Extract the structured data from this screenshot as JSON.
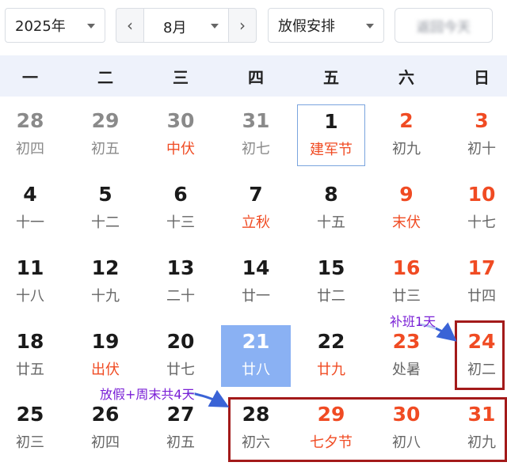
{
  "toolbar": {
    "year_label": "2025年",
    "month_label": "8月",
    "prev_arrow": "‹",
    "next_arrow": "›",
    "holiday_label": "放假安排",
    "today_label": "返回今天"
  },
  "weekdays": [
    "一",
    "二",
    "三",
    "四",
    "五",
    "六",
    "日"
  ],
  "days": [
    {
      "n": "28",
      "s": "初四"
    },
    {
      "n": "29",
      "s": "初五"
    },
    {
      "n": "30",
      "s": "中伏"
    },
    {
      "n": "31",
      "s": "初七"
    },
    {
      "n": "1",
      "s": "建军节"
    },
    {
      "n": "2",
      "s": "初九"
    },
    {
      "n": "3",
      "s": "初十"
    },
    {
      "n": "4",
      "s": "十一"
    },
    {
      "n": "5",
      "s": "十二"
    },
    {
      "n": "6",
      "s": "十三"
    },
    {
      "n": "7",
      "s": "立秋"
    },
    {
      "n": "8",
      "s": "十五"
    },
    {
      "n": "9",
      "s": "末伏"
    },
    {
      "n": "10",
      "s": "十七"
    },
    {
      "n": "11",
      "s": "十八"
    },
    {
      "n": "12",
      "s": "十九"
    },
    {
      "n": "13",
      "s": "二十"
    },
    {
      "n": "14",
      "s": "廿一"
    },
    {
      "n": "15",
      "s": "廿二"
    },
    {
      "n": "16",
      "s": "廿三"
    },
    {
      "n": "17",
      "s": "廿四"
    },
    {
      "n": "18",
      "s": "廿五"
    },
    {
      "n": "19",
      "s": "出伏"
    },
    {
      "n": "20",
      "s": "廿七"
    },
    {
      "n": "21",
      "s": "廿八"
    },
    {
      "n": "22",
      "s": "廿九"
    },
    {
      "n": "23",
      "s": "处暑"
    },
    {
      "n": "24",
      "s": "初二"
    },
    {
      "n": "25",
      "s": "初三"
    },
    {
      "n": "26",
      "s": "初四"
    },
    {
      "n": "27",
      "s": "初五"
    },
    {
      "n": "28",
      "s": "初六"
    },
    {
      "n": "29",
      "s": "七夕节"
    },
    {
      "n": "30",
      "s": "初八"
    },
    {
      "n": "31",
      "s": "初九"
    }
  ],
  "annotations": {
    "makeup_workday": "补班1天",
    "holiday_note": "放假+周末共4天"
  },
  "colors": {
    "weekend_red": "#f04b23",
    "selected_blue": "#8ab1f3",
    "today_border": "#7aa4de",
    "annotation_box": "#a31a1a",
    "annotation_text": "#7a1fd6",
    "arrow_blue": "#3a63d6",
    "header_bg": "#eef2fb"
  }
}
